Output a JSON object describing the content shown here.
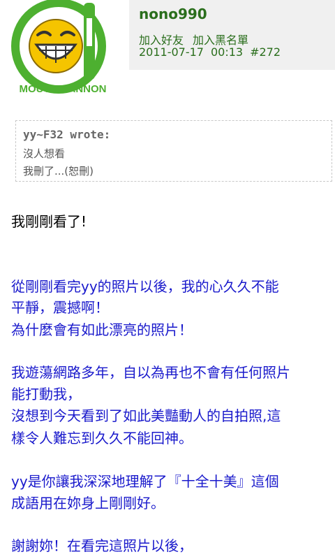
{
  "header": {
    "avatar_caption": "MOUTH CANNON",
    "username": "nono990",
    "add_friend_label": "加入好友",
    "add_blacklist_label": "加入黑名單",
    "date": "2011-07-17",
    "time": "00:13",
    "post_number": "#272"
  },
  "quote": {
    "author": "yy~F32 wrote:",
    "lines": [
      "沒人想看",
      "我刪了...(恕刪)"
    ]
  },
  "post": {
    "intro": "我剛剛看了!",
    "paragraph1": [
      "從剛剛看完yy的照片以後，我的心久久不能",
      "平靜，震撼啊！",
      "為什麼會有如此漂亮的照片！"
    ],
    "paragraph2": [
      "我遊蕩網路多年，自以為再也不會有任何照片",
      "能打動我，",
      "沒想到今天看到了如此美豔動人的自拍照,這",
      "樣令人難忘到久久不能回神。"
    ],
    "paragraph3": [
      "yy是你讓我深深地理解了『十全十美』這個",
      "成語用在妳身上剛剛好。"
    ],
    "paragraph4": [
      "謝謝妳！在看完這照片以後，"
    ]
  },
  "colors": {
    "username_green": "#2a6e1c",
    "post_blue": "#1a1acc",
    "logo_green": "#4db030",
    "smiley_yellow": "#f5c400"
  }
}
